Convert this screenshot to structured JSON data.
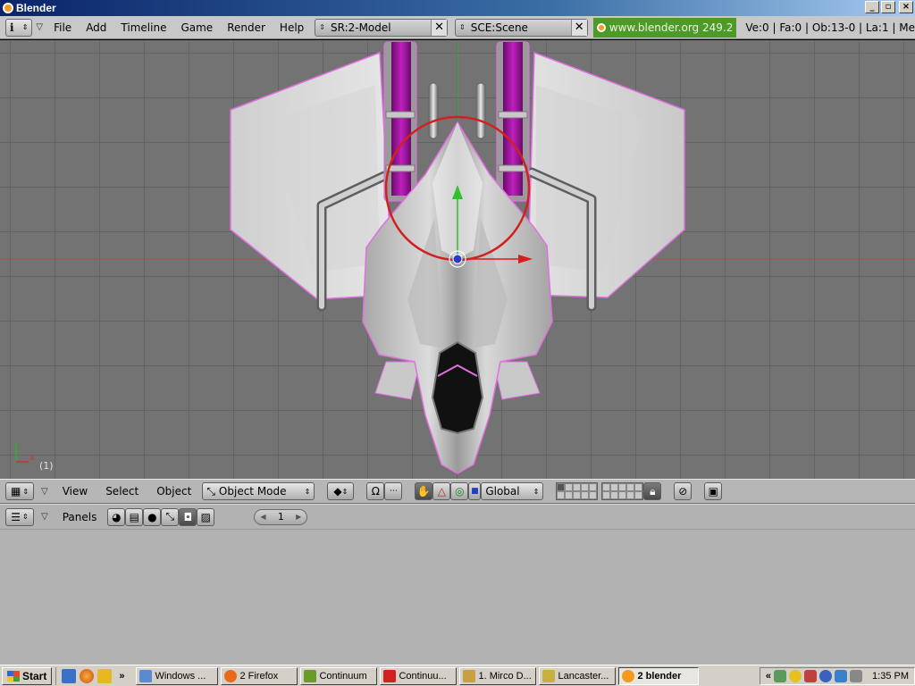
{
  "window": {
    "title": "Blender",
    "min_glyph": "_",
    "max_glyph": "▫",
    "close_glyph": "×"
  },
  "info": {
    "menus": [
      "File",
      "Add",
      "Timeline",
      "Game",
      "Render",
      "Help"
    ],
    "screen_field": "SR:2-Model",
    "scene_field": "SCE:Scene",
    "website": "www.blender.org 249.2",
    "stats": "Ve:0 | Fa:0 | Ob:13-0 | La:1  | Me"
  },
  "viewport": {
    "frame_label": "(1)",
    "axis_x": "x",
    "bg": "#737373",
    "selection_color": "#e070e0",
    "manip_circle": "#d02020"
  },
  "header3d": {
    "view": "View",
    "select": "Select",
    "object": "Object",
    "mode": "Object Mode",
    "orientation": "Global"
  },
  "buttons": {
    "panels": "Panels",
    "frame": "1",
    "prev": "◀",
    "next": "▶"
  },
  "taskbar": {
    "start": "Start",
    "more": "»",
    "tasks": [
      {
        "label": "Windows ...",
        "color": "#5a8ad0"
      },
      {
        "label": "2 Firefox",
        "color": "#e86a1a"
      },
      {
        "label": "Continuum",
        "color": "#6a9a2a"
      },
      {
        "label": "Continuu...",
        "color": "#d02020"
      },
      {
        "label": "1. Mirco D...",
        "color": "#c8a040"
      },
      {
        "label": "Lancaster...",
        "color": "#c8b040"
      },
      {
        "label": "2 blender",
        "color": "#f39a1f"
      }
    ],
    "tray_expand": "«",
    "clock": "1:35 PM"
  }
}
